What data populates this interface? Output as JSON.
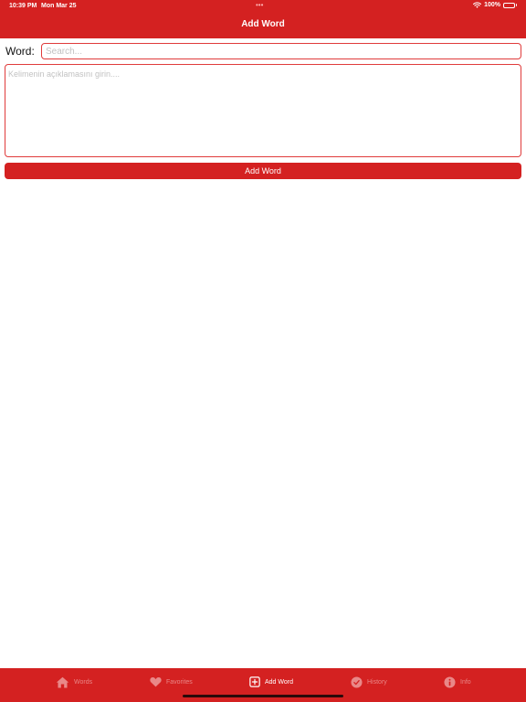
{
  "status_bar": {
    "time": "10:39 PM",
    "date": "Mon Mar 25",
    "dots": "•••",
    "battery": "100%",
    "wifi_icon": "wifi-icon",
    "battery_icon": "battery-icon"
  },
  "nav": {
    "title": "Add Word"
  },
  "form": {
    "word_label": "Word:",
    "word_placeholder": "Search...",
    "word_value": "",
    "description_placeholder": "Kelimenin açıklamasını girin....",
    "description_value": "",
    "submit_label": "Add Word"
  },
  "tab_bar": {
    "items": [
      {
        "label": "Words",
        "icon": "house-icon",
        "active": false
      },
      {
        "label": "Favorites",
        "icon": "heart-icon",
        "active": false
      },
      {
        "label": "Add Word",
        "icon": "plus-square-icon",
        "active": true
      },
      {
        "label": "History",
        "icon": "clock-check-icon",
        "active": false
      },
      {
        "label": "Info",
        "icon": "info-circle-icon",
        "active": false
      }
    ]
  },
  "colors": {
    "brand_red": "#d42121",
    "border_red": "#e03b3b",
    "inactive_tab": "#e98888",
    "placeholder": "#c2c2c2"
  }
}
